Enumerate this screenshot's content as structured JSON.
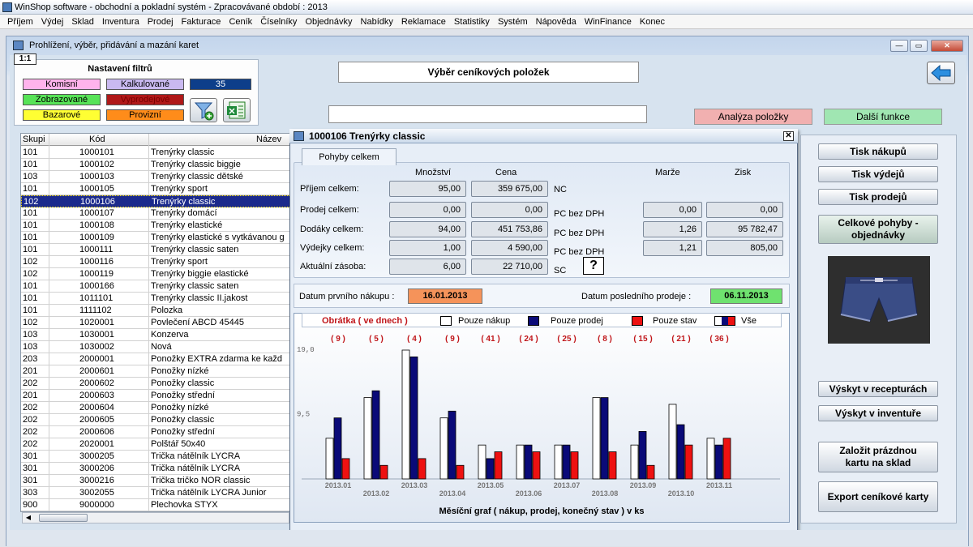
{
  "app": {
    "title": "WinShop software - obchodní a pokladní systém - Zpracovávané období : 2013"
  },
  "menu": [
    "Příjem",
    "Výdej",
    "Sklad",
    "Inventura",
    "Prodej",
    "Fakturace",
    "Ceník",
    "Číselníky",
    "Objednávky",
    "Nabídky",
    "Reklamace",
    "Statistiky",
    "Systém",
    "Nápověda",
    "WinFinance",
    "Konec"
  ],
  "window": {
    "title": "Prohlížení, výběr, přidávání a mazání karet",
    "scale": "1:1"
  },
  "filter": {
    "title": "Nastavení filtrů",
    "chips": [
      {
        "label": "Komisní",
        "color": "#ffb3ec"
      },
      {
        "label": "Kalkulované",
        "color": "#c9b9f0"
      },
      {
        "label": "Zobrazované",
        "color": "#57e357"
      },
      {
        "label": "Vyprodejové",
        "color": "#b01818"
      },
      {
        "label": "Bazarové",
        "color": "#ffff33"
      },
      {
        "label": "Provizní",
        "color": "#ff8c1a"
      }
    ],
    "count": "35"
  },
  "search": {
    "title": "Výběr ceníkových položek",
    "value": ""
  },
  "buttons": {
    "analyza": "Analýza položky",
    "dalsi": "Další funkce"
  },
  "grid": {
    "headers": {
      "skupina": "Skupi",
      "kod": "Kód",
      "nazev": "Název"
    },
    "rows": [
      {
        "g": "101",
        "k": "1000101",
        "n": "Trenýrky classic"
      },
      {
        "g": "101",
        "k": "1000102",
        "n": "Trenýrky classic biggie"
      },
      {
        "g": "103",
        "k": "1000103",
        "n": "Trenýrky classic dětské"
      },
      {
        "g": "101",
        "k": "1000105",
        "n": "Trenýrky sport"
      },
      {
        "g": "102",
        "k": "1000106",
        "n": "Trenýrky classic"
      },
      {
        "g": "101",
        "k": "1000107",
        "n": "Trenýrky domácí"
      },
      {
        "g": "101",
        "k": "1000108",
        "n": "Trenýrky elastické"
      },
      {
        "g": "101",
        "k": "1000109",
        "n": "Trenýrky elastické s vytkávanou g"
      },
      {
        "g": "101",
        "k": "1000111",
        "n": "Trenýrky classic saten"
      },
      {
        "g": "102",
        "k": "1000116",
        "n": "Trenýrky sport"
      },
      {
        "g": "102",
        "k": "1000119",
        "n": "Trenýrky biggie elastické"
      },
      {
        "g": "101",
        "k": "1000166",
        "n": "Trenýrky classic saten"
      },
      {
        "g": "101",
        "k": "1011101",
        "n": "Trenýrky classic II.jakost"
      },
      {
        "g": "101",
        "k": "1111102",
        "n": "Polozka"
      },
      {
        "g": "102",
        "k": "1020001",
        "n": "Povlečení ABCD 45445"
      },
      {
        "g": "103",
        "k": "1030001",
        "n": "Konzerva"
      },
      {
        "g": "103",
        "k": "1030002",
        "n": "Nová"
      },
      {
        "g": "203",
        "k": "2000001",
        "n": "Ponožky EXTRA zdarma ke každ"
      },
      {
        "g": "201",
        "k": "2000601",
        "n": "Ponožky nízké"
      },
      {
        "g": "202",
        "k": "2000602",
        "n": "Ponožky classic"
      },
      {
        "g": "201",
        "k": "2000603",
        "n": "Ponožky střední"
      },
      {
        "g": "202",
        "k": "2000604",
        "n": "Ponožky nízké"
      },
      {
        "g": "202",
        "k": "2000605",
        "n": "Ponožky classic"
      },
      {
        "g": "202",
        "k": "2000606",
        "n": "Ponožky střední"
      },
      {
        "g": "202",
        "k": "2020001",
        "n": "Polštář 50x40"
      },
      {
        "g": "301",
        "k": "3000205",
        "n": "Trička nátělník LYCRA"
      },
      {
        "g": "301",
        "k": "3000206",
        "n": "Trička nátělník LYCRA"
      },
      {
        "g": "301",
        "k": "3000216",
        "n": "Trička tričko NOR classic"
      },
      {
        "g": "303",
        "k": "3002055",
        "n": "Trička nátělník LYCRA Junior"
      },
      {
        "g": "900",
        "k": "9000000",
        "n": "Plechovka STYX"
      }
    ],
    "selected_index": 4
  },
  "dialog": {
    "title": "1000106  Trenýrky classic",
    "tab": "Pohyby celkem",
    "col_headers": {
      "mnozstvi": "Množství",
      "cena": "Cena",
      "marze": "Marže",
      "zisk": "Zisk"
    },
    "rows": [
      {
        "label": "Příjem celkem:",
        "qty": "95,00",
        "price": "359 675,00",
        "unit": "NC"
      },
      {
        "label": "Prodej celkem:",
        "qty": "0,00",
        "price": "0,00",
        "unit": "PC bez DPH",
        "marze": "0,00",
        "zisk": "0,00"
      },
      {
        "label": "Dodáky celkem:",
        "qty": "94,00",
        "price": "451 753,86",
        "unit": "PC bez DPH",
        "marze": "1,26",
        "zisk": "95 782,47"
      },
      {
        "label": "Výdejky celkem:",
        "qty": "1,00",
        "price": "4 590,00",
        "unit": "PC bez DPH",
        "marze": "1,21",
        "zisk": "805,00"
      },
      {
        "label": "Aktuální zásoba:",
        "qty": "6,00",
        "price": "22 710,00",
        "unit": "SC"
      }
    ],
    "help": "?",
    "dates": {
      "first_label": "Datum prvního nákupu :",
      "first_value": "16.01.2013",
      "last_label": "Datum posledního prodeje :",
      "last_value": "06.11.2013"
    },
    "legend": {
      "obratka": "Obrátka ( ve dnech )",
      "nakup": "Pouze nákup",
      "prodej": "Pouze prodej",
      "stav": "Pouze stav",
      "vse": "Vše"
    }
  },
  "chart_data": {
    "type": "bar",
    "categories": [
      "2013.01",
      "2013.02",
      "2013.03",
      "2013.04",
      "2013.05",
      "2013.06",
      "2013.07",
      "2013.08",
      "2013.09",
      "2013.10",
      "2013.11"
    ],
    "turnover_labels": [
      "( 9 )",
      "( 5 )",
      "( 4 )",
      "( 9 )",
      "( 41 )",
      "( 24 )",
      "( 25 )",
      "( 8 )",
      "( 15 )",
      "( 21 )",
      "( 36 )"
    ],
    "series": [
      {
        "name": "Pouze nákup",
        "color": "#ffffff",
        "values": [
          6,
          12,
          19,
          9,
          5,
          5,
          5,
          12,
          5,
          11,
          6
        ]
      },
      {
        "name": "Pouze prodej",
        "color": "#0a0a78",
        "values": [
          9,
          13,
          18,
          10,
          3,
          5,
          5,
          12,
          7,
          8,
          5
        ]
      },
      {
        "name": "Pouze stav",
        "color": "#ee1111",
        "values": [
          3,
          2,
          3,
          2,
          4,
          4,
          4,
          4,
          2,
          5,
          6
        ]
      }
    ],
    "ytick_labels": [
      "19,0",
      "9,5"
    ],
    "ylim": [
      0,
      19
    ],
    "xlabel": "Měsíční graf ( nákup, prodej, konečný stav ) v ks",
    "legend_position": "top"
  },
  "right": {
    "tisk_nakupu": "Tisk nákupů",
    "tisk_vydeju": "Tisk výdejů",
    "tisk_prodeju": "Tisk prodejů",
    "celkove": "Celkové pohyby - objednávky",
    "vyskyt_receptury": "Výskyt v recepturách",
    "vyskyt_inventure": "Výskyt v inventuře",
    "zalozit": "Založit prázdnou kartu na sklad",
    "export": "Export ceníkové karty"
  }
}
